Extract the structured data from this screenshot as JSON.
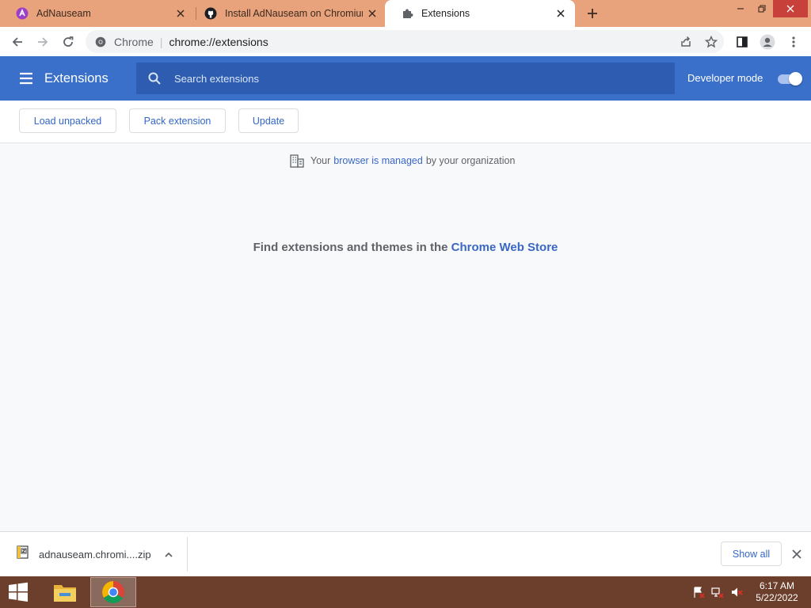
{
  "tabs": [
    {
      "title": "AdNauseam",
      "active": false,
      "icon": "adnauseam-icon"
    },
    {
      "title": "Install AdNauseam on Chromium",
      "active": false,
      "icon": "github-icon"
    },
    {
      "title": "Extensions",
      "active": true,
      "icon": "puzzle-icon"
    }
  ],
  "omnibox": {
    "scheme": "Chrome",
    "url": "chrome://extensions"
  },
  "header": {
    "title": "Extensions",
    "search_placeholder": "Search extensions",
    "developer_mode_label": "Developer mode",
    "developer_mode_on": true
  },
  "devbar": {
    "load_unpacked": "Load unpacked",
    "pack_extension": "Pack extension",
    "update": "Update"
  },
  "managed": {
    "prefix": "Your",
    "link": "browser is managed",
    "suffix": "by your organization"
  },
  "empty_state": {
    "text": "Find extensions and themes in the",
    "link": "Chrome Web Store"
  },
  "download": {
    "filename": "adnauseam.chromi....zip",
    "show_all": "Show all"
  },
  "taskbar": {
    "time": "6:17 AM",
    "date": "5/22/2022"
  },
  "colors": {
    "tabstrip": "#e8a27c",
    "header": "#3a70c9",
    "search": "#2e5cb0",
    "link": "#3a67c5",
    "taskbar": "#6b3f2c"
  }
}
